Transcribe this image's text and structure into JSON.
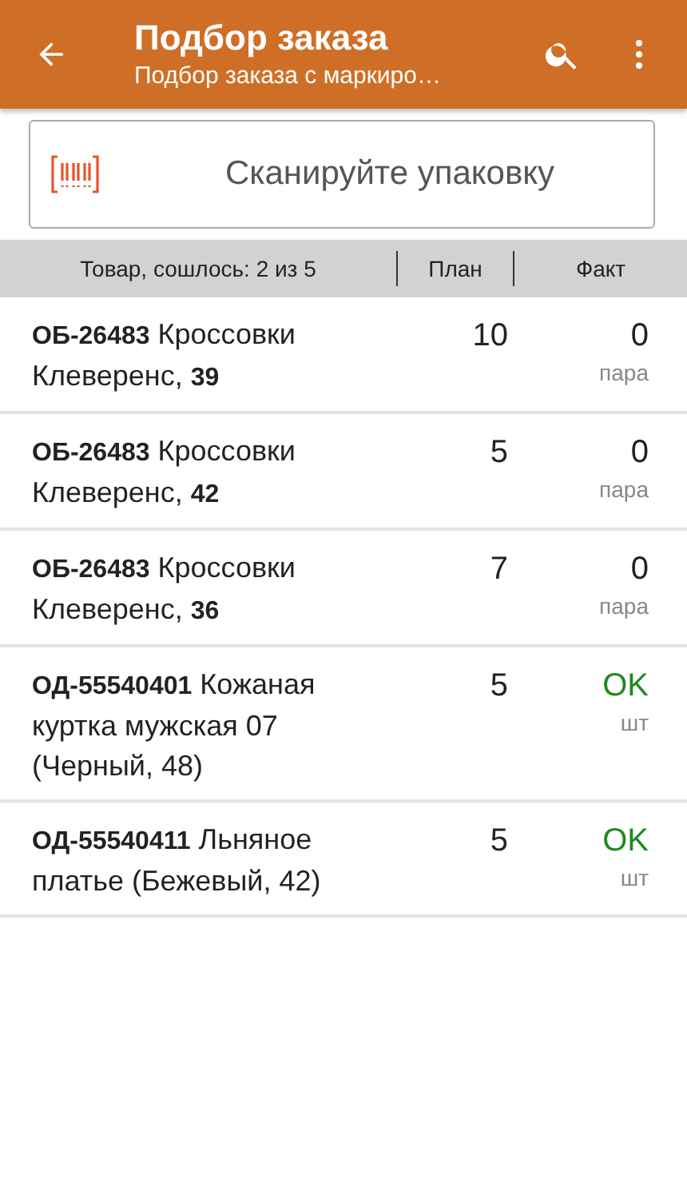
{
  "app_bar": {
    "title": "Подбор заказа",
    "subtitle": "Подбор заказа с маркиро…"
  },
  "scan_field": {
    "placeholder": "Сканируйте упаковку"
  },
  "columns": [
    "Товар, сошлось: 2 из 5",
    "План",
    "Факт"
  ],
  "rows": [
    {
      "name": "**ОБ-26483** Кроссовки Клеверенс, **39**",
      "plan": "10",
      "fact": "0",
      "unit": "пара",
      "matched": false
    },
    {
      "name": "**ОБ-26483** Кроссовки Клеверенс, **42**",
      "plan": "5",
      "fact": "0",
      "unit": "пара",
      "matched": false
    },
    {
      "name": "**ОБ-26483** Кроссовки Клеверенс, **36**",
      "plan": "7",
      "fact": "0",
      "unit": "пара",
      "matched": false
    },
    {
      "name": "**ОД-55540401** Кожаная куртка мужская 07 (Черный, 48)",
      "plan": "5",
      "fact": "OK",
      "unit": "шт",
      "matched": true
    },
    {
      "name": "**ОД-55540411** Льняное платье (Бежевый, 42)",
      "plan": "5",
      "fact": "OK",
      "unit": "шт",
      "matched": true
    }
  ]
}
